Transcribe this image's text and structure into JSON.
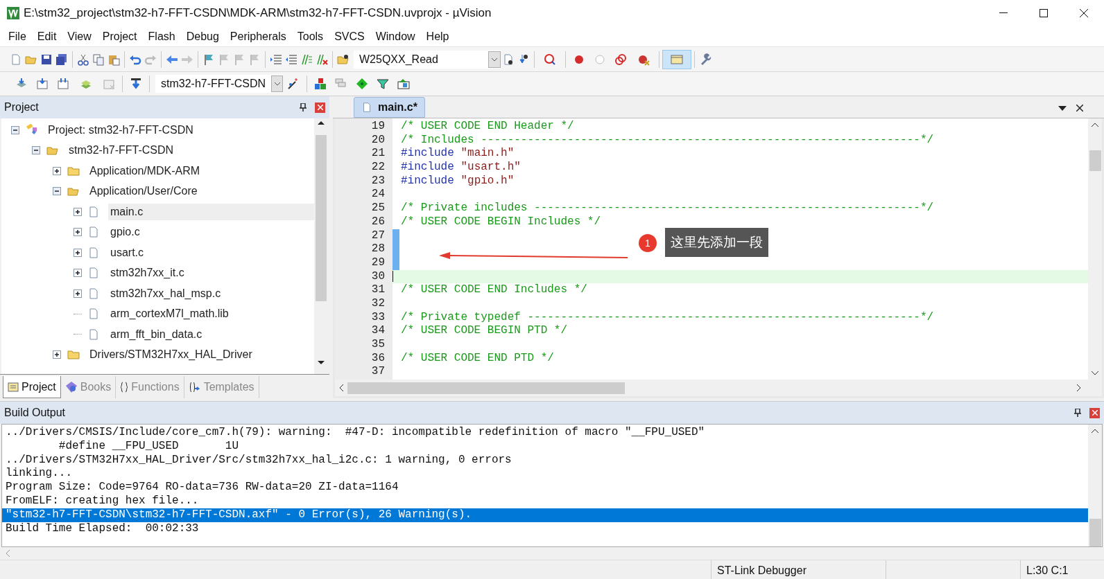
{
  "window": {
    "title": "E:\\stm32_project\\stm32-h7-FFT-CSDN\\MDK-ARM\\stm32-h7-FFT-CSDN.uvprojx - µVision"
  },
  "menu": [
    "File",
    "Edit",
    "View",
    "Project",
    "Flash",
    "Debug",
    "Peripherals",
    "Tools",
    "SVCS",
    "Window",
    "Help"
  ],
  "toolbar": {
    "target_dropdown": "W25QXX_Read",
    "project_dropdown": "stm32-h7-FFT-CSDN"
  },
  "project_panel": {
    "title": "Project",
    "tree": [
      {
        "label": "Project: stm32-h7-FFT-CSDN",
        "kind": "root",
        "expandable": true,
        "expanded": true,
        "selected": false,
        "children": [
          {
            "label": "stm32-h7-FFT-CSDN",
            "kind": "target",
            "expandable": true,
            "expanded": true,
            "selected": false,
            "children": [
              {
                "label": "Application/MDK-ARM",
                "kind": "group",
                "expandable": true,
                "expanded": false,
                "selected": false
              },
              {
                "label": "Application/User/Core",
                "kind": "group",
                "expandable": true,
                "expanded": true,
                "selected": false,
                "children": [
                  {
                    "label": "main.c",
                    "kind": "file",
                    "expandable": true,
                    "expanded": false,
                    "selected": true
                  },
                  {
                    "label": "gpio.c",
                    "kind": "file",
                    "expandable": true,
                    "expanded": false,
                    "selected": false
                  },
                  {
                    "label": "usart.c",
                    "kind": "file",
                    "expandable": true,
                    "expanded": false,
                    "selected": false
                  },
                  {
                    "label": "stm32h7xx_it.c",
                    "kind": "file",
                    "expandable": true,
                    "expanded": false,
                    "selected": false
                  },
                  {
                    "label": "stm32h7xx_hal_msp.c",
                    "kind": "file",
                    "expandable": true,
                    "expanded": false,
                    "selected": false
                  },
                  {
                    "label": "arm_cortexM7l_math.lib",
                    "kind": "file",
                    "expandable": false,
                    "expanded": false,
                    "selected": false
                  },
                  {
                    "label": "arm_fft_bin_data.c",
                    "kind": "file",
                    "expandable": false,
                    "expanded": false,
                    "selected": false
                  }
                ]
              },
              {
                "label": "Drivers/STM32H7xx_HAL_Driver",
                "kind": "group",
                "expandable": true,
                "expanded": false,
                "selected": false
              }
            ]
          }
        ]
      }
    ],
    "tabs": [
      {
        "label": "Project",
        "kind": "project",
        "selected": true
      },
      {
        "label": "Books",
        "kind": "books",
        "selected": false
      },
      {
        "label": "Functions",
        "kind": "functions",
        "selected": false
      },
      {
        "label": "Templates",
        "kind": "templates",
        "selected": false
      }
    ]
  },
  "editor": {
    "tabs": [
      {
        "label": "main.c*",
        "selected": true
      }
    ],
    "lines": [
      {
        "number": "19",
        "kind": "comment",
        "text": "/* USER CODE END Header */",
        "changed": false,
        "current": false
      },
      {
        "number": "20",
        "kind": "comment",
        "text": "/* Includes ------------------------------------------------------------------*/",
        "changed": false,
        "current": false
      },
      {
        "number": "21",
        "kind": "include",
        "directive": "#include",
        "text": "\"main.h\"",
        "changed": false,
        "current": false
      },
      {
        "number": "22",
        "kind": "include",
        "directive": "#include",
        "text": "\"usart.h\"",
        "changed": false,
        "current": false
      },
      {
        "number": "23",
        "kind": "include",
        "directive": "#include",
        "text": "\"gpio.h\"",
        "changed": false,
        "current": false
      },
      {
        "number": "24",
        "kind": "blank",
        "changed": false,
        "current": false
      },
      {
        "number": "25",
        "kind": "comment",
        "text": "/* Private includes ----------------------------------------------------------*/",
        "changed": false,
        "current": false
      },
      {
        "number": "26",
        "kind": "comment",
        "text": "/* USER CODE BEGIN Includes */",
        "changed": false,
        "current": false
      },
      {
        "number": "27",
        "kind": "blank",
        "changed": true,
        "current": false
      },
      {
        "number": "28",
        "kind": "blank",
        "changed": true,
        "current": false
      },
      {
        "number": "29",
        "kind": "blank",
        "changed": true,
        "current": false
      },
      {
        "number": "30",
        "kind": "blank",
        "changed": false,
        "current": true
      },
      {
        "number": "31",
        "kind": "comment",
        "text": "/* USER CODE END Includes */",
        "changed": false,
        "current": false
      },
      {
        "number": "32",
        "kind": "blank",
        "changed": false,
        "current": false
      },
      {
        "number": "33",
        "kind": "comment",
        "text": "/* Private typedef -----------------------------------------------------------*/",
        "changed": false,
        "current": false
      },
      {
        "number": "34",
        "kind": "comment",
        "text": "/* USER CODE BEGIN PTD */",
        "changed": false,
        "current": false
      },
      {
        "number": "35",
        "kind": "blank",
        "changed": false,
        "current": false
      },
      {
        "number": "36",
        "kind": "comment",
        "text": "/* USER CODE END PTD */",
        "changed": false,
        "current": false
      },
      {
        "number": "37",
        "kind": "blank",
        "changed": false,
        "current": false
      }
    ],
    "annotation": {
      "badge": "1",
      "text": "这里先添加一段"
    }
  },
  "build_output": {
    "title": "Build Output",
    "lines": [
      {
        "text": "../Drivers/CMSIS/Include/core_cm7.h(79): warning:  #47-D: incompatible redefinition of macro \"__FPU_USED\"",
        "selected": false
      },
      {
        "text": "        #define __FPU_USED       1U",
        "selected": false
      },
      {
        "text": "../Drivers/STM32H7xx_HAL_Driver/Src/stm32h7xx_hal_i2c.c: 1 warning, 0 errors",
        "selected": false
      },
      {
        "text": "linking...",
        "selected": false
      },
      {
        "text": "Program Size: Code=9764 RO-data=736 RW-data=20 ZI-data=1164",
        "selected": false
      },
      {
        "text": "FromELF: creating hex file...",
        "selected": false
      },
      {
        "text": "\"stm32-h7-FFT-CSDN\\stm32-h7-FFT-CSDN.axf\" - 0 Error(s), 26 Warning(s).",
        "selected": true
      },
      {
        "text": "Build Time Elapsed:  00:02:33",
        "selected": false
      }
    ]
  },
  "status_bar": {
    "debugger": "ST-Link Debugger",
    "position": "L:30 C:1"
  }
}
